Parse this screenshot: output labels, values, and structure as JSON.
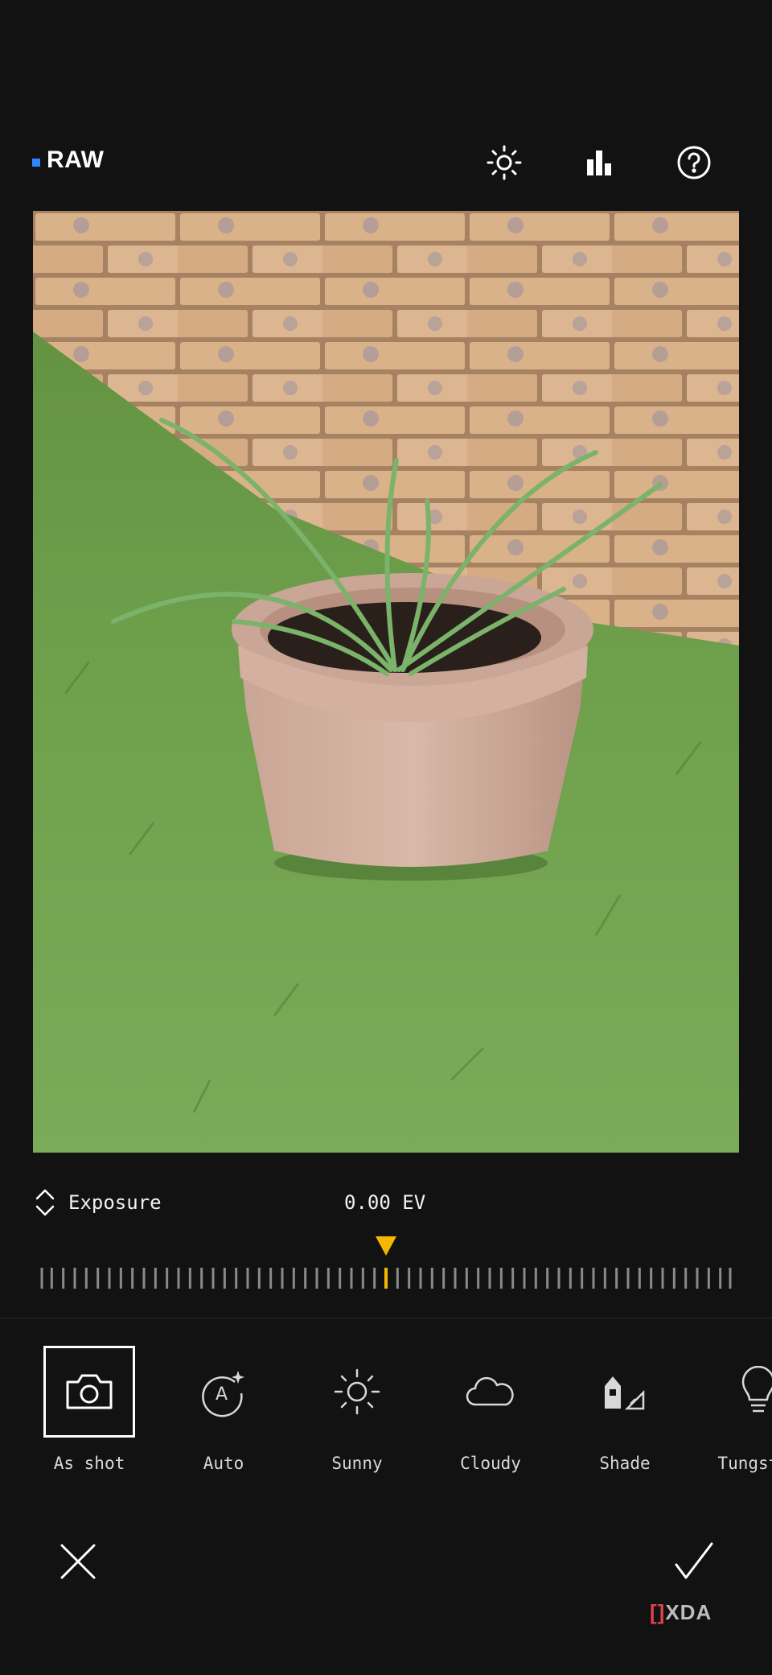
{
  "header": {
    "mode_label": "RAW",
    "icons": [
      "sun-icon",
      "histogram-icon",
      "help-icon"
    ]
  },
  "photo": {
    "description_icon": "plant-photo"
  },
  "exposure": {
    "label": "Exposure",
    "value": "0.00 EV",
    "slider_position": 0.5
  },
  "white_balance": {
    "items": [
      {
        "label": "As shot",
        "icon": "camera-icon",
        "selected": true
      },
      {
        "label": "Auto",
        "icon": "auto-icon",
        "selected": false
      },
      {
        "label": "Sunny",
        "icon": "sunny-icon",
        "selected": false
      },
      {
        "label": "Cloudy",
        "icon": "cloudy-icon",
        "selected": false
      },
      {
        "label": "Shade",
        "icon": "shade-icon",
        "selected": false
      },
      {
        "label": "Tungsten",
        "icon": "tungsten-icon",
        "selected": false
      }
    ]
  },
  "actions": {
    "cancel_icon": "close-icon",
    "confirm_icon": "check-icon"
  },
  "watermark": {
    "bracket": "[]",
    "text": "XDA"
  },
  "colors": {
    "background": "#121212",
    "accent_blue": "#2f86ff",
    "accent_yellow": "#f5b800"
  }
}
